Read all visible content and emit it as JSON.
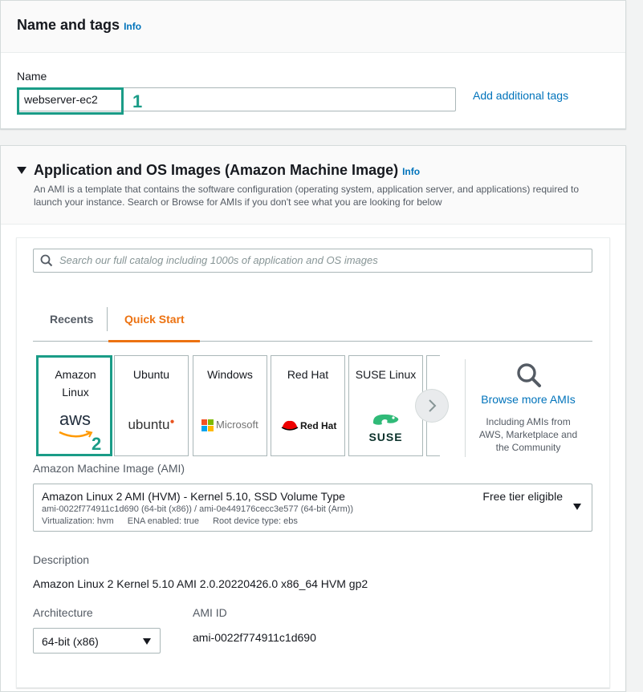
{
  "name_tags": {
    "title": "Name and tags",
    "info": "Info",
    "name_label": "Name",
    "name_value": "webserver-ec2",
    "add_tags": "Add additional tags",
    "step": "1"
  },
  "ami_section": {
    "title": "Application and OS Images (Amazon Machine Image)",
    "info": "Info",
    "description": "An AMI is a template that contains the software configuration (operating system, application server, and applications) required to launch your instance. Search or Browse for AMIs if you don't see what you are looking for below",
    "search_placeholder": "Search our full catalog including 1000s of application and OS images",
    "tabs": {
      "recents": "Recents",
      "quick_start": "Quick Start"
    },
    "tiles": {
      "amazon": "Amazon Linux",
      "amazon_logo": "aws",
      "ubuntu": "Ubuntu",
      "ubuntu_logo": "ubuntu",
      "windows": "Windows",
      "windows_logo": "Microsoft",
      "redhat": "Red Hat",
      "redhat_logo": "Red Hat",
      "suse": "SUSE Linux",
      "suse_logo": "SUSE"
    },
    "step": "2",
    "browse": {
      "title": "Browse more AMIs",
      "subtitle": "Including AMIs from AWS, Marketplace and the Community"
    },
    "ami_label": "Amazon Machine Image (AMI)",
    "ami_select": {
      "name": "Amazon Linux 2 AMI (HVM) - Kernel 5.10, SSD Volume Type",
      "badge": "Free tier eligible",
      "ids": "ami-0022f774911c1d690 (64-bit (x86)) / ami-0e449176cecc3e577 (64-bit (Arm))",
      "virt": "Virtualization: hvm",
      "ena": "ENA enabled: true",
      "root": "Root device type: ebs"
    },
    "desc_label": "Description",
    "desc_value": "Amazon Linux 2 Kernel 5.10 AMI 2.0.20220426.0 x86_64 HVM gp2",
    "arch_label": "Architecture",
    "arch_value": "64-bit (x86)",
    "ami_id_label": "AMI ID",
    "ami_id_value": "ami-0022f774911c1d690"
  },
  "colors": {
    "accent": "#0073bb",
    "tab_active": "#ec7211",
    "highlight": "#1a9c87"
  }
}
